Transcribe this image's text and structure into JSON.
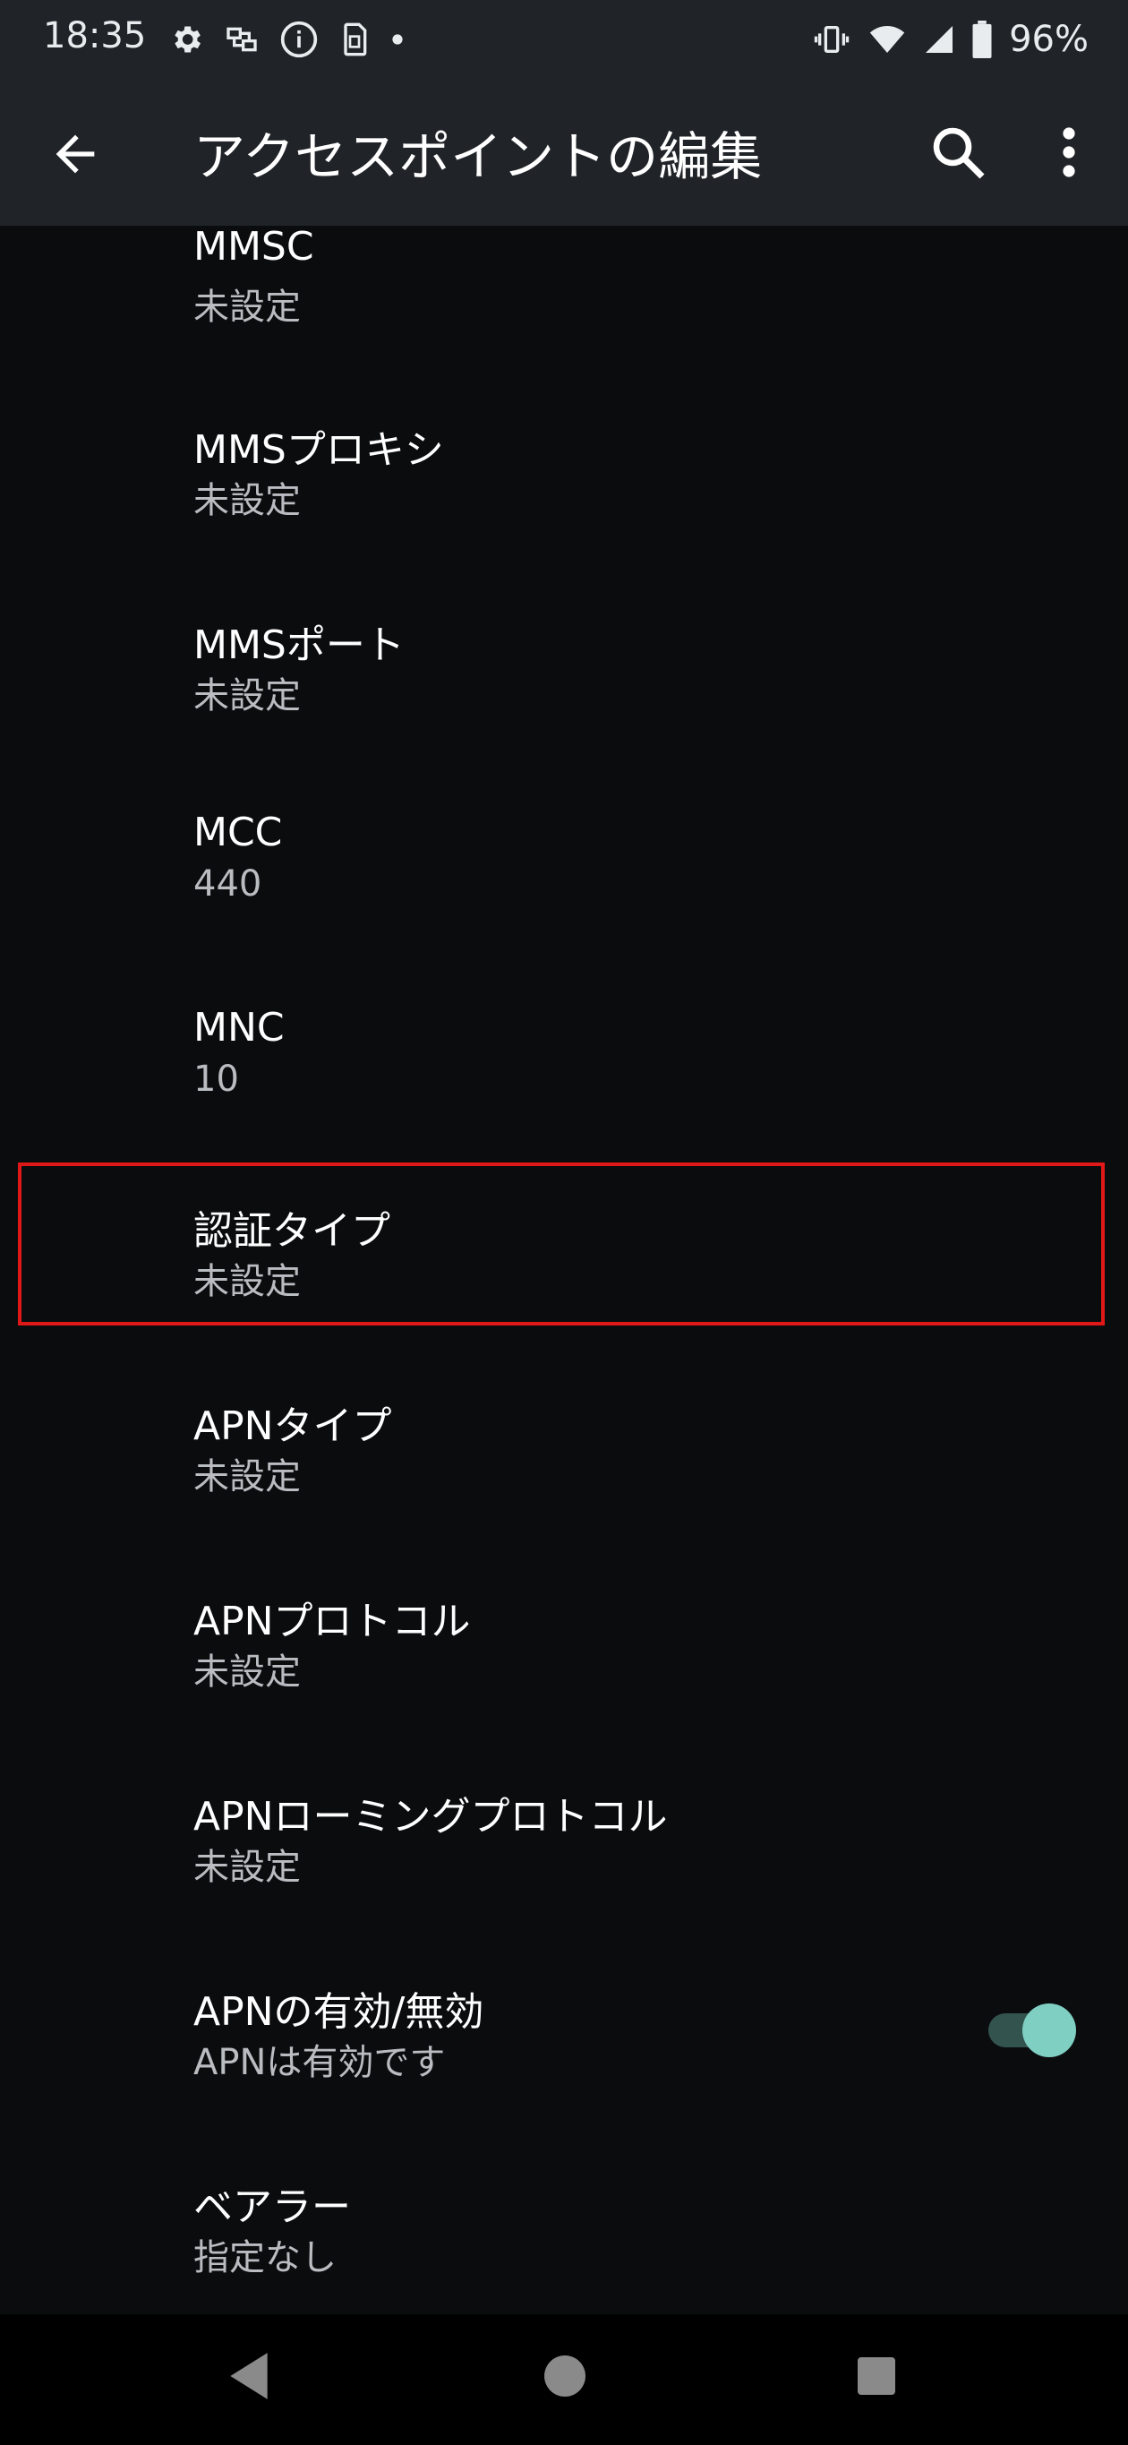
{
  "status": {
    "time": "18:35",
    "battery_pct": "96%",
    "left_icons": [
      "gear-icon",
      "hub-icon",
      "info-icon",
      "sim-icon",
      "dot-icon"
    ],
    "right_icons": [
      "vibrate-icon",
      "wifi-icon",
      "signal-icon",
      "battery-icon"
    ]
  },
  "appbar": {
    "title": "アクセスポイントの編集",
    "back_icon": "arrow-back-icon",
    "search_icon": "search-icon",
    "more_icon": "more-vert-icon"
  },
  "items": [
    {
      "title": "MMSC",
      "summary": "未設定"
    },
    {
      "title": "MMSプロキシ",
      "summary": "未設定"
    },
    {
      "title": "MMSポート",
      "summary": "未設定"
    },
    {
      "title": "MCC",
      "summary": "440"
    },
    {
      "title": "MNC",
      "summary": "10"
    },
    {
      "title": "認証タイプ",
      "summary": "未設定"
    },
    {
      "title": "APNタイプ",
      "summary": "未設定"
    },
    {
      "title": "APNプロトコル",
      "summary": "未設定"
    },
    {
      "title": "APNローミングプロトコル",
      "summary": "未設定"
    },
    {
      "title": "APNの有効/無効",
      "summary": "APNは有効です",
      "toggle_on": true
    },
    {
      "title": "ベアラー",
      "summary": "指定なし"
    }
  ],
  "highlight_color": "#e01818",
  "accent_color": "#7fcfc3",
  "nav": {
    "icons": [
      "nav-back-icon",
      "nav-home-icon",
      "nav-recents-icon"
    ]
  }
}
